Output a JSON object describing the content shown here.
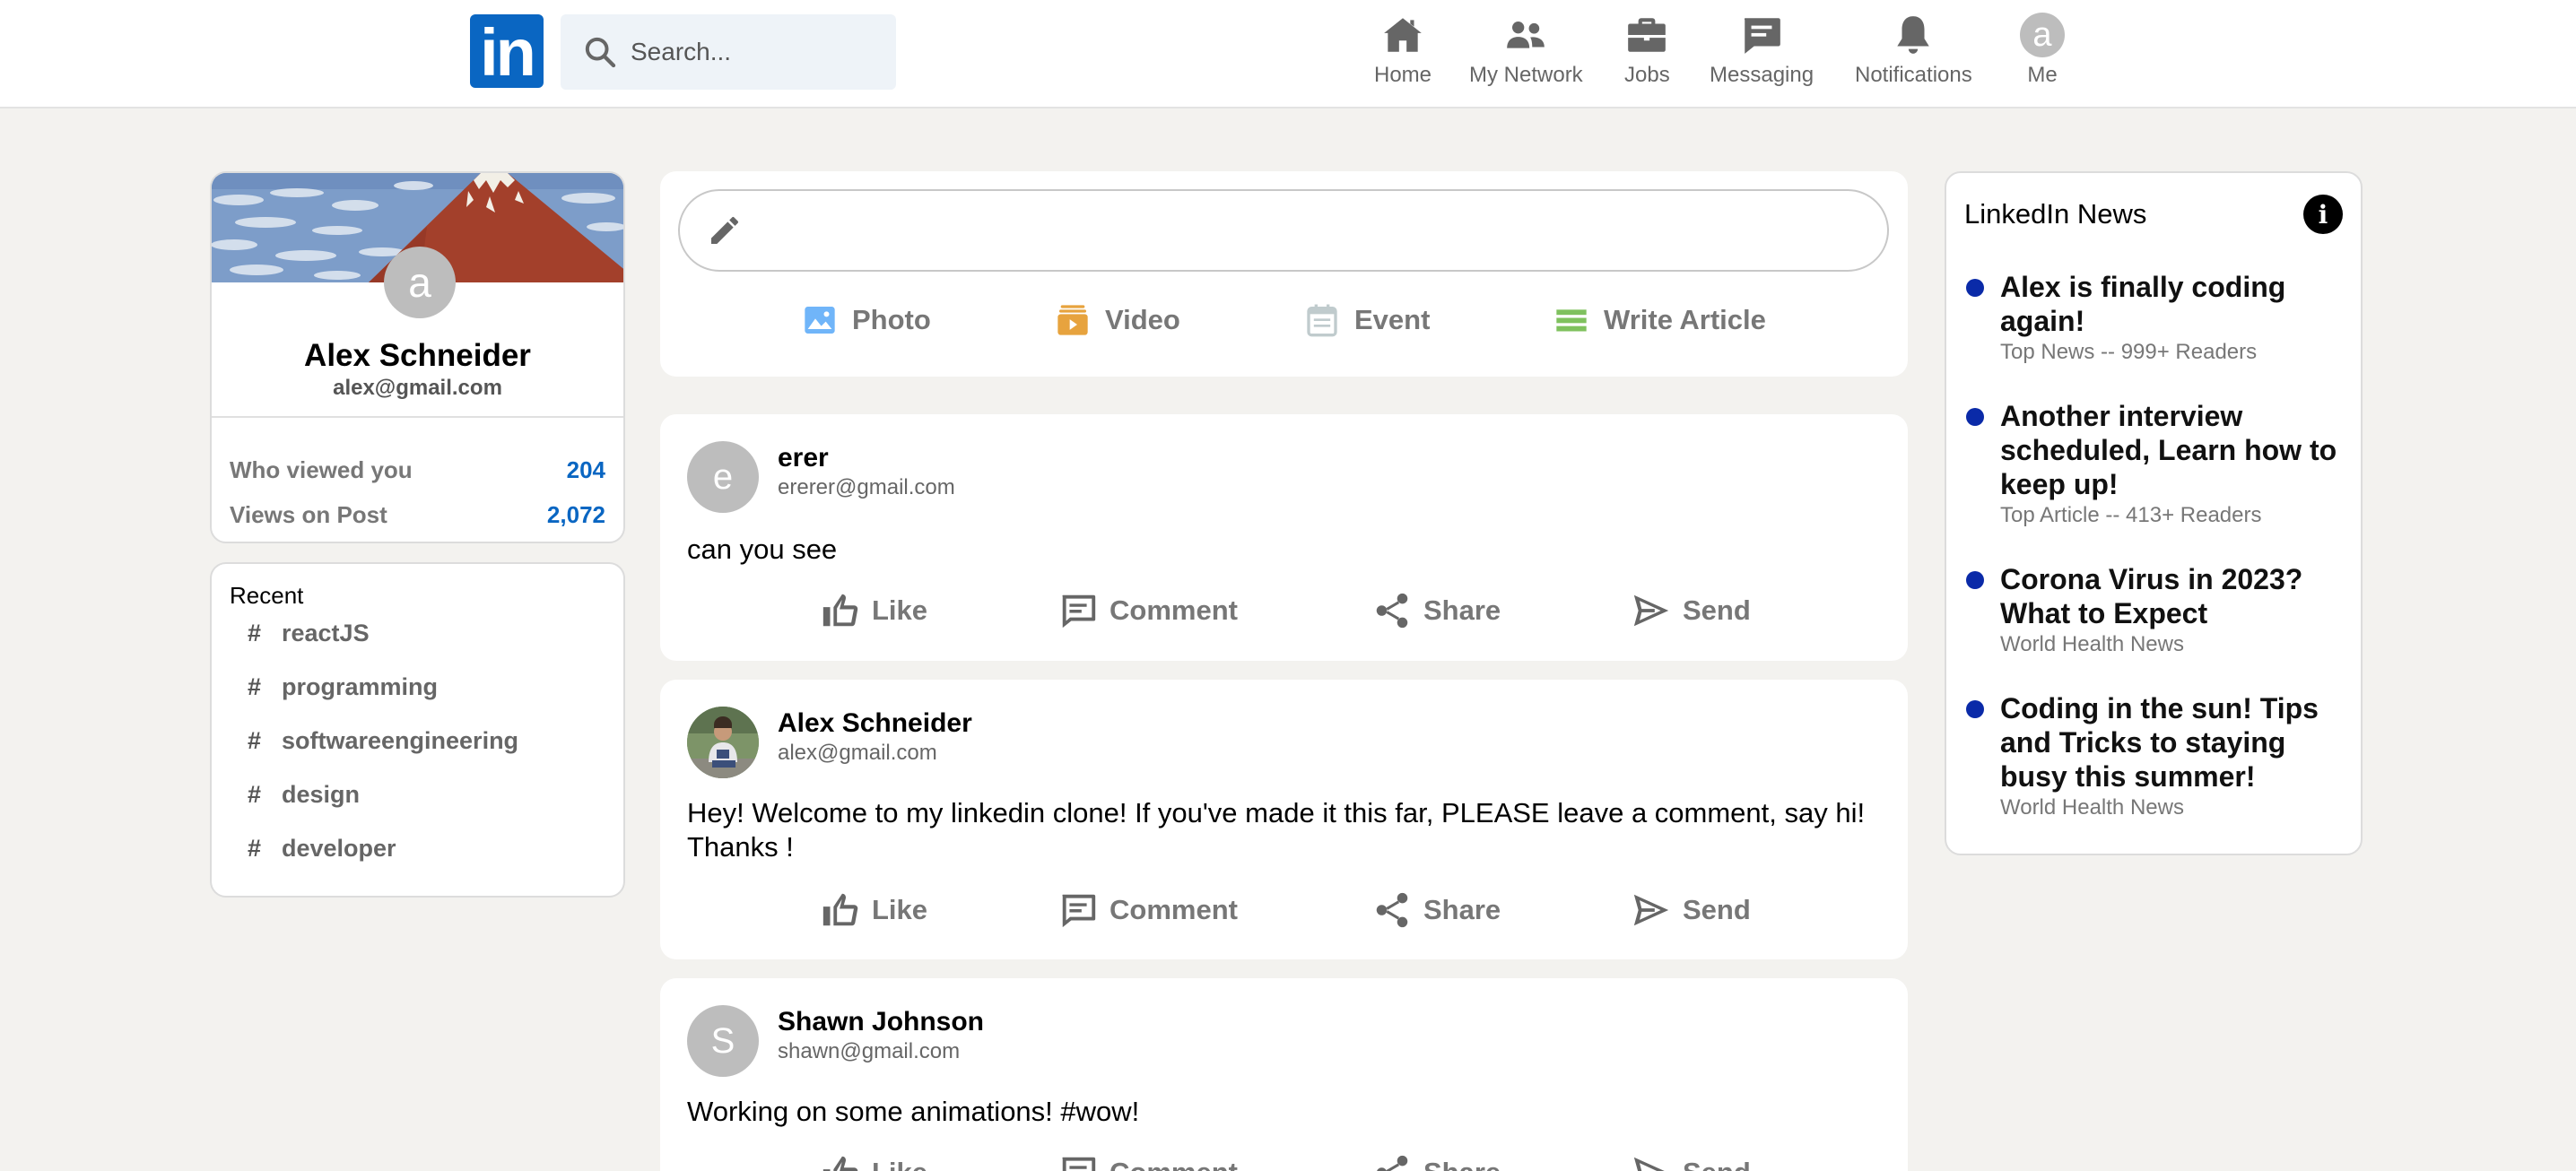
{
  "header": {
    "logo_text": "in",
    "search_placeholder": "Search...",
    "nav": [
      {
        "label": "Home",
        "icon": "home-icon"
      },
      {
        "label": "My Network",
        "icon": "network-icon"
      },
      {
        "label": "Jobs",
        "icon": "briefcase-icon"
      },
      {
        "label": "Messaging",
        "icon": "message-icon"
      },
      {
        "label": "Notifications",
        "icon": "bell-icon"
      },
      {
        "label": "Me",
        "avatar_letter": "a"
      }
    ]
  },
  "profile": {
    "avatar_letter": "a",
    "name": "Alex Schneider",
    "email": "alex@gmail.com",
    "stats": [
      {
        "label": "Who viewed you",
        "value": "204"
      },
      {
        "label": "Views on Post",
        "value": "2,072"
      }
    ]
  },
  "recent": {
    "title": "Recent",
    "hash": "#",
    "items": [
      "reactJS",
      "programming",
      "softwareengineering",
      "design",
      "developer"
    ]
  },
  "share": {
    "options": [
      {
        "label": "Photo",
        "icon": "photo-icon",
        "color": "#70b5f9"
      },
      {
        "label": "Video",
        "icon": "video-icon",
        "color": "#e7a33e"
      },
      {
        "label": "Event",
        "icon": "calendar-icon",
        "color": "#c0cbcd"
      },
      {
        "label": "Write Article",
        "icon": "article-icon",
        "color": "#7fc15e"
      }
    ]
  },
  "post_actions": [
    "Like",
    "Comment",
    "Share",
    "Send"
  ],
  "posts": [
    {
      "avatar_letter": "e",
      "author": "erer",
      "email": "ererer@gmail.com",
      "text": "can you see"
    },
    {
      "avatar_letter": "",
      "author": "Alex Schneider",
      "email": "alex@gmail.com",
      "text": "Hey! Welcome to my linkedin clone! If you've made it this far, PLEASE leave a comment, say hi! Thanks !"
    },
    {
      "avatar_letter": "S",
      "author": "Shawn Johnson",
      "email": "shawn@gmail.com",
      "text": "Working on some animations! #wow!"
    }
  ],
  "news": {
    "title": "LinkedIn News",
    "info_glyph": "i",
    "items": [
      {
        "headline": "Alex is finally coding again!",
        "meta": "Top News -- 999+ Readers"
      },
      {
        "headline": "Another interview scheduled, Learn how to keep up!",
        "meta": "Top Article -- 413+ Readers"
      },
      {
        "headline": "Corona Virus in 2023? What to Expect",
        "meta": "World Health News"
      },
      {
        "headline": "Coding in the sun! Tips and Tricks to staying busy this summer!",
        "meta": "World Health News"
      }
    ]
  },
  "colors": {
    "brand": "#0a66c2",
    "page_bg": "#f3f2ef",
    "news_bullet": "#0a2aa8"
  }
}
